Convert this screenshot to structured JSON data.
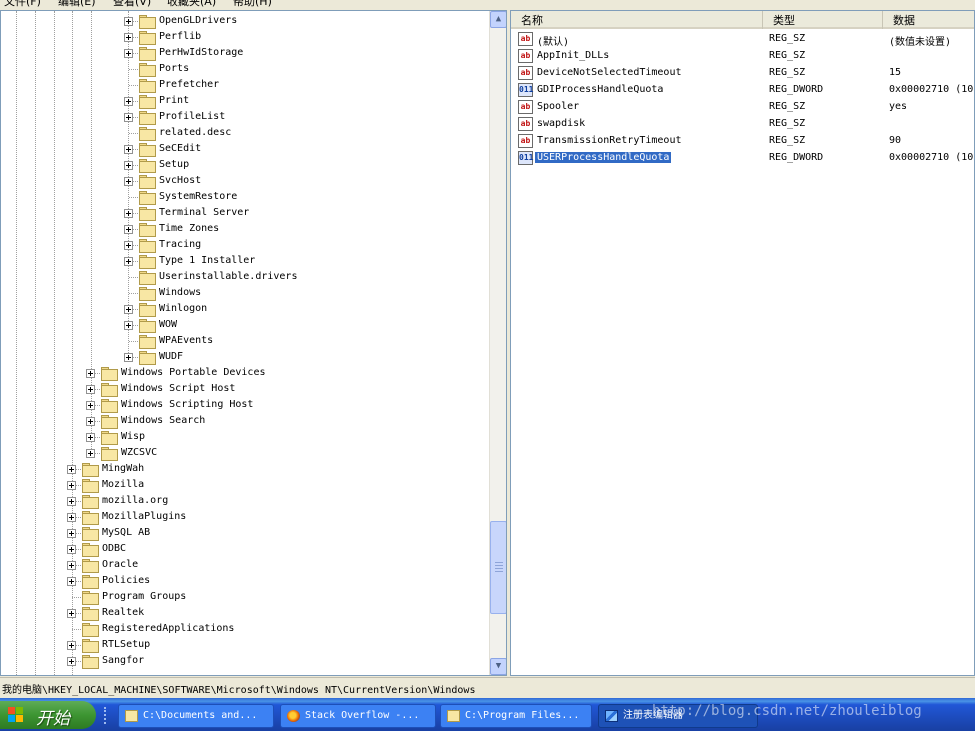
{
  "menu": [
    "文件(F)",
    "编辑(E)",
    "查看(V)",
    "收藏夹(A)",
    "帮助(H)"
  ],
  "tree_rows": [
    {
      "label": "OpenGLDrivers",
      "level": 3,
      "expandable": true
    },
    {
      "label": "Perflib",
      "level": 3,
      "expandable": true
    },
    {
      "label": "PerHwIdStorage",
      "level": 3,
      "expandable": true
    },
    {
      "label": "Ports",
      "level": 3,
      "expandable": false
    },
    {
      "label": "Prefetcher",
      "level": 3,
      "expandable": false
    },
    {
      "label": "Print",
      "level": 3,
      "expandable": true
    },
    {
      "label": "ProfileList",
      "level": 3,
      "expandable": true
    },
    {
      "label": "related.desc",
      "level": 3,
      "expandable": false
    },
    {
      "label": "SeCEdit",
      "level": 3,
      "expandable": true
    },
    {
      "label": "Setup",
      "level": 3,
      "expandable": true
    },
    {
      "label": "SvcHost",
      "level": 3,
      "expandable": true
    },
    {
      "label": "SystemRestore",
      "level": 3,
      "expandable": false
    },
    {
      "label": "Terminal Server",
      "level": 3,
      "expandable": true
    },
    {
      "label": "Time Zones",
      "level": 3,
      "expandable": true
    },
    {
      "label": "Tracing",
      "level": 3,
      "expandable": true
    },
    {
      "label": "Type 1 Installer",
      "level": 3,
      "expandable": true
    },
    {
      "label": "Userinstallable.drivers",
      "level": 3,
      "expandable": false
    },
    {
      "label": "Windows",
      "level": 3,
      "expandable": false,
      "open": true
    },
    {
      "label": "Winlogon",
      "level": 3,
      "expandable": true
    },
    {
      "label": "WOW",
      "level": 3,
      "expandable": true
    },
    {
      "label": "WPAEvents",
      "level": 3,
      "expandable": false
    },
    {
      "label": "WUDF",
      "level": 3,
      "expandable": true
    },
    {
      "label": "Windows Portable Devices",
      "level": 2,
      "expandable": true
    },
    {
      "label": "Windows Script Host",
      "level": 2,
      "expandable": true
    },
    {
      "label": "Windows Scripting Host",
      "level": 2,
      "expandable": true
    },
    {
      "label": "Windows Search",
      "level": 2,
      "expandable": true
    },
    {
      "label": "Wisp",
      "level": 2,
      "expandable": true
    },
    {
      "label": "WZCSVC",
      "level": 2,
      "expandable": true
    },
    {
      "label": "MingWah",
      "level": 1,
      "expandable": true
    },
    {
      "label": "Mozilla",
      "level": 1,
      "expandable": true
    },
    {
      "label": "mozilla.org",
      "level": 1,
      "expandable": true
    },
    {
      "label": "MozillaPlugins",
      "level": 1,
      "expandable": true
    },
    {
      "label": "MySQL AB",
      "level": 1,
      "expandable": true
    },
    {
      "label": "ODBC",
      "level": 1,
      "expandable": true
    },
    {
      "label": "Oracle",
      "level": 1,
      "expandable": true
    },
    {
      "label": "Policies",
      "level": 1,
      "expandable": true
    },
    {
      "label": "Program Groups",
      "level": 1,
      "expandable": false
    },
    {
      "label": "Realtek",
      "level": 1,
      "expandable": true
    },
    {
      "label": "RegisteredApplications",
      "level": 1,
      "expandable": false
    },
    {
      "label": "RTLSetup",
      "level": 1,
      "expandable": true
    },
    {
      "label": "Sangfor",
      "level": 1,
      "expandable": true
    }
  ],
  "list": {
    "columns": [
      "名称",
      "类型",
      "数据"
    ],
    "rows": [
      {
        "icon": "ab",
        "name": "(默认)",
        "type": "REG_SZ",
        "data": "(数值未设置)"
      },
      {
        "icon": "ab",
        "name": "AppInit_DLLs",
        "type": "REG_SZ",
        "data": ""
      },
      {
        "icon": "ab",
        "name": "DeviceNotSelectedTimeout",
        "type": "REG_SZ",
        "data": "15"
      },
      {
        "icon": "bin",
        "name": "GDIProcessHandleQuota",
        "type": "REG_DWORD",
        "data": "0x00002710 (10"
      },
      {
        "icon": "ab",
        "name": "Spooler",
        "type": "REG_SZ",
        "data": "yes"
      },
      {
        "icon": "ab",
        "name": "swapdisk",
        "type": "REG_SZ",
        "data": ""
      },
      {
        "icon": "ab",
        "name": "TransmissionRetryTimeout",
        "type": "REG_SZ",
        "data": "90"
      },
      {
        "icon": "bin",
        "name": "USERProcessHandleQuota",
        "type": "REG_DWORD",
        "data": "0x00002710 (10",
        "selected": true
      }
    ]
  },
  "status_path": "我的电脑\\HKEY_LOCAL_MACHINE\\SOFTWARE\\Microsoft\\Windows NT\\CurrentVersion\\Windows",
  "taskbar": {
    "start_label": "开始",
    "buttons": [
      {
        "label": "C:\\Documents and...",
        "icon": "folder-icon"
      },
      {
        "label": "Stack Overflow -...",
        "icon": "firefox-icon"
      },
      {
        "label": "C:\\Program Files...",
        "icon": "folder-icon"
      },
      {
        "label": "注册表编辑器",
        "icon": "regedit-icon",
        "active": true
      }
    ],
    "watermark": "http://blog.csdn.net/zhouleiblog"
  },
  "colors": {
    "selection": "#316ac5",
    "taskbar": "#245edc",
    "start": "#3d9532"
  }
}
